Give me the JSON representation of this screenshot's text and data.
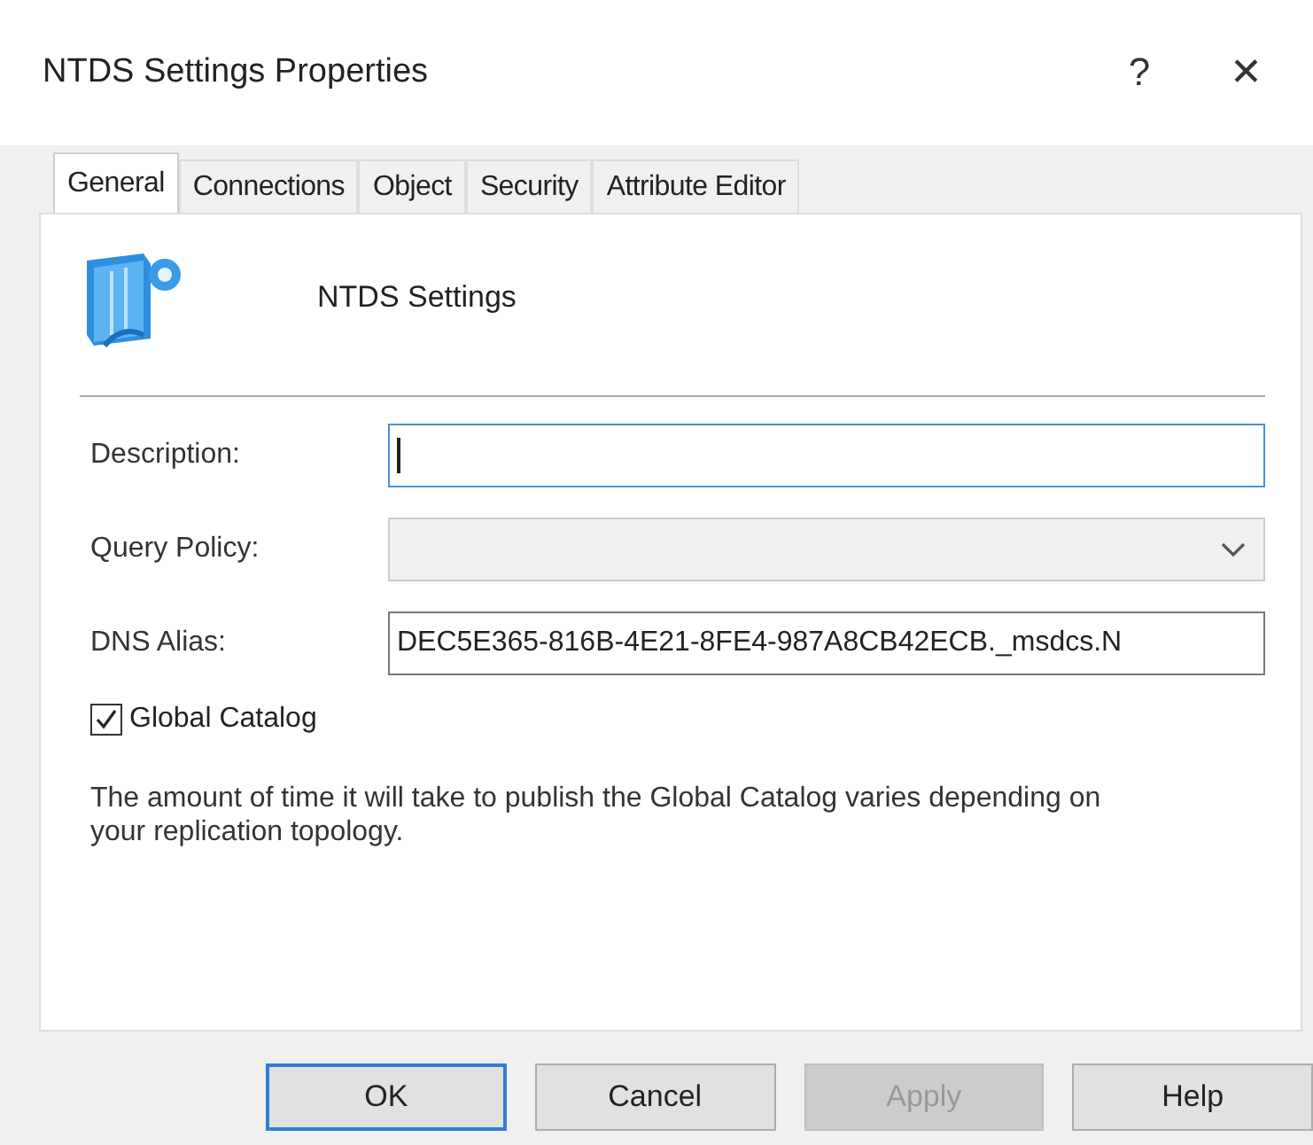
{
  "window": {
    "title": "NTDS Settings Properties",
    "help": "?",
    "close": "✕"
  },
  "tabs": [
    {
      "label": "General",
      "selected": true
    },
    {
      "label": "Connections",
      "selected": false
    },
    {
      "label": "Object",
      "selected": false
    },
    {
      "label": "Security",
      "selected": false
    },
    {
      "label": "Attribute Editor",
      "selected": false
    }
  ],
  "header": {
    "name": "NTDS Settings"
  },
  "fields": [
    {
      "label": "Description:",
      "kind": "text",
      "focused": true,
      "disabled": false
    },
    {
      "label": "Query Policy:",
      "kind": "combo",
      "focused": false,
      "disabled": true
    },
    {
      "label": "DNS Alias:",
      "kind": "text",
      "value": "DEC5E365-816B-4E21-8FE4-987A8CB42ECB._msdcs.N",
      "focused": false,
      "disabled": false
    }
  ],
  "global_catalog": {
    "label": "Global Catalog",
    "checked": true
  },
  "note": "The amount of time it will take to publish the Global Catalog varies depending on your replication topology.",
  "buttons": [
    {
      "label": "OK",
      "default": true,
      "disabled": false
    },
    {
      "label": "Cancel",
      "default": false,
      "disabled": false
    },
    {
      "label": "Apply",
      "default": false,
      "disabled": true
    },
    {
      "label": "Help",
      "default": false,
      "disabled": false
    }
  ]
}
